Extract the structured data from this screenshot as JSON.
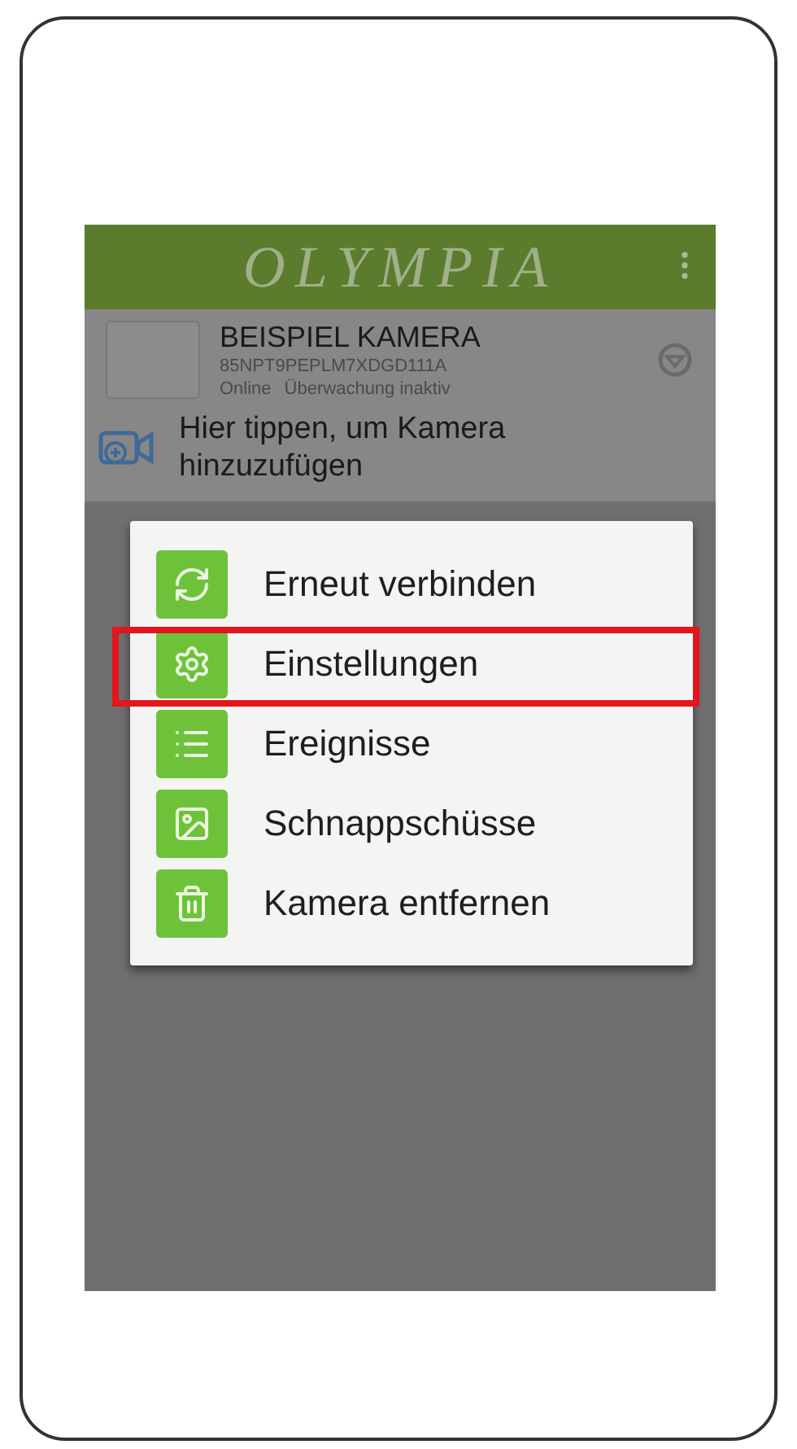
{
  "app_bar": {
    "title": "OLYMPIA"
  },
  "camera": {
    "name": "BEISPIEL KAMERA",
    "id": "85NPT9PEPLM7XDGD111A",
    "status": "Online",
    "monitoring": "Überwachung inaktiv"
  },
  "add_camera": {
    "label": "Hier tippen, um Kamera hinzuzufügen"
  },
  "menu": [
    {
      "kind": "reconnect",
      "label": "Erneut verbinden",
      "highlighted": false
    },
    {
      "kind": "settings",
      "label": "Einstellungen",
      "highlighted": true
    },
    {
      "kind": "events",
      "label": "Ereignisse",
      "highlighted": false
    },
    {
      "kind": "snapshots",
      "label": "Schnappschüsse",
      "highlighted": false
    },
    {
      "kind": "remove",
      "label": "Kamera entfernen",
      "highlighted": false
    }
  ]
}
